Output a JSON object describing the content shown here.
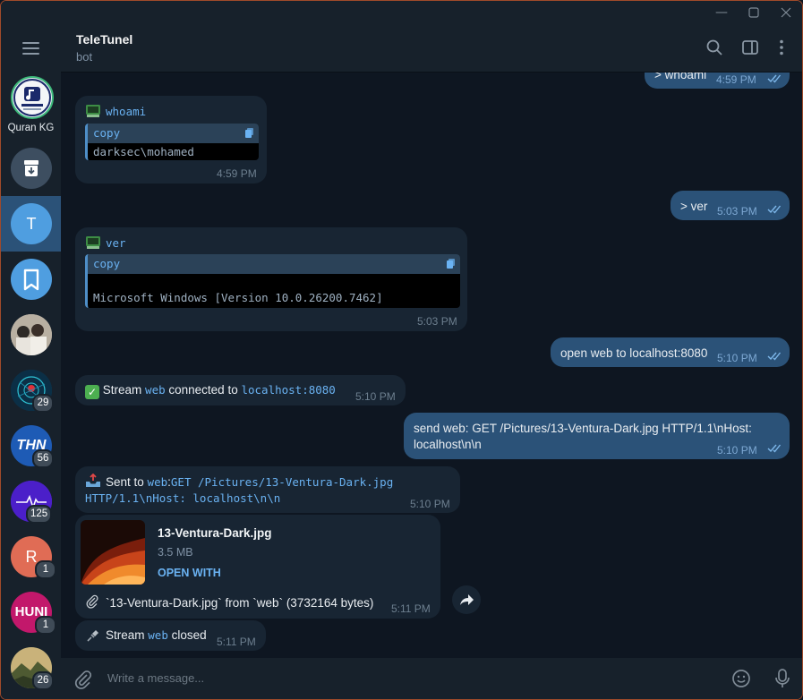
{
  "window": {
    "min_icon": "minimize-icon",
    "max_icon": "maximize-icon",
    "close_icon": "close-icon"
  },
  "sidebar": {
    "menu_icon": "hamburger-icon",
    "folders": [
      {
        "label": "Quran KG",
        "badge": ""
      },
      {
        "label": "",
        "badge": "",
        "icon": "archive-icon"
      },
      {
        "label": "",
        "avatar_letter": "T",
        "badge": "",
        "selected": true
      },
      {
        "label": "",
        "icon": "bookmark-icon",
        "badge": ""
      },
      {
        "label": "",
        "badge": ""
      },
      {
        "label": "",
        "badge": "29"
      },
      {
        "label": "",
        "avatar_letter": "THN",
        "badge": "56"
      },
      {
        "label": "",
        "badge": "125"
      },
      {
        "label": "",
        "avatar_letter": "R",
        "badge": "1"
      },
      {
        "label": "",
        "avatar_letter": "HUNI",
        "badge": "1"
      },
      {
        "label": "",
        "badge": "26"
      }
    ]
  },
  "header": {
    "title": "TeleTunel",
    "subtitle": "bot"
  },
  "messages": {
    "m0": {
      "text": "> whoami",
      "time": "4:59 PM"
    },
    "m1": {
      "label": "whoami",
      "copy": "copy",
      "code": "darksec\\mohamed",
      "time": "4:59 PM"
    },
    "m2": {
      "text": "> ver",
      "time": "5:03 PM"
    },
    "m3": {
      "label": "ver",
      "copy": "copy",
      "code": "Microsoft Windows [Version 10.0.26200.7462]",
      "time": "5:03 PM"
    },
    "m4": {
      "text": "open web to localhost:8080",
      "time": "5:10 PM"
    },
    "m5": {
      "pre": "Stream",
      "web": "web",
      "mid": "connected to",
      "host": "localhost:8080",
      "time": "5:10 PM"
    },
    "m6": {
      "line1": "send web: GET /Pictures/13-Ventura-Dark.jpg HTTP/1.1\\nHost:",
      "line2": "localhost\\n\\n",
      "time": "5:10 PM"
    },
    "m7": {
      "pre": "Sent to",
      "web": "web",
      "colon": ":",
      "line1": "GET /Pictures/13-Ventura-Dark.jpg",
      "line2": "HTTP/1.1\\nHost: localhost\\n\\n",
      "time": "5:10 PM"
    },
    "m8": {
      "file_name": "13-Ventura-Dark.jpg",
      "file_size": "3.5 MB",
      "open_with": "OPEN WITH",
      "caption": "`13-Ventura-Dark.jpg` from `web` (3732164 bytes)",
      "time": "5:11 PM"
    },
    "m9": {
      "pre": "Stream",
      "web": "web",
      "post": "closed",
      "time": "5:11 PM"
    }
  },
  "composer": {
    "placeholder": "Write a message..."
  },
  "colors": {
    "bg": "#0e1621",
    "panel": "#17212b",
    "incoming": "#182533",
    "outgoing": "#2b5278",
    "accent": "#6ab2f2"
  }
}
